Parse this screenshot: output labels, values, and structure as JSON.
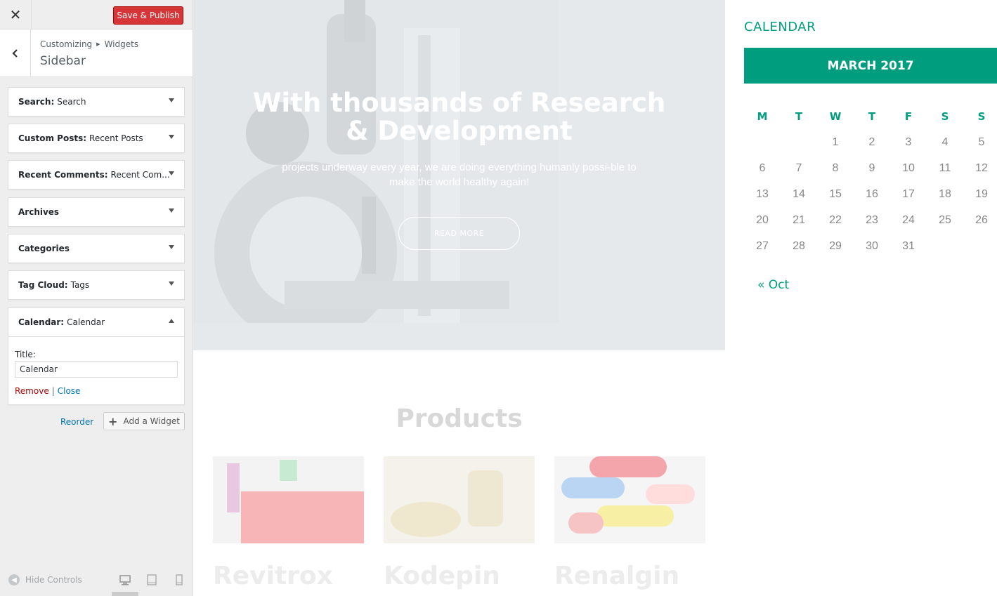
{
  "customizer": {
    "close_icon": "close-icon",
    "publish_label": "Save & Publish",
    "breadcrumb": [
      "Customizing",
      "Widgets"
    ],
    "section_title": "Sidebar",
    "widgets": [
      {
        "name": "Search:",
        "title": "Search"
      },
      {
        "name": "Custom Posts:",
        "title": "Recent Posts"
      },
      {
        "name": "Recent Comments:",
        "title": "Recent Com..."
      },
      {
        "name": "Archives",
        "title": ""
      },
      {
        "name": "Categories",
        "title": ""
      },
      {
        "name": "Tag Cloud:",
        "title": "Tags"
      },
      {
        "name": "Calendar:",
        "title": "Calendar"
      }
    ],
    "calendar_form": {
      "title_label": "Title:",
      "title_value": "Calendar",
      "remove_label": "Remove",
      "separator": "|",
      "close_label": "Close"
    },
    "reorder_label": "Reorder",
    "add_widget_label": "Add a Widget",
    "hide_controls_label": "Hide Controls"
  },
  "preview": {
    "hero": {
      "heading": "With thousands of Research & Development",
      "text": "projects underway every year, we are doing everything humanly possi-ble to make the world healthy again!",
      "button": "READ MORE"
    },
    "products_title": "Products",
    "products": [
      {
        "name": "Revitrox"
      },
      {
        "name": "Kodepin"
      },
      {
        "name": "Renalgin"
      }
    ],
    "calendar": {
      "widget_title": "CALENDAR",
      "caption": "MARCH 2017",
      "weekdays": [
        "M",
        "T",
        "W",
        "T",
        "F",
        "S",
        "S"
      ],
      "weeks": [
        [
          "",
          "",
          "1",
          "2",
          "3",
          "4",
          "5"
        ],
        [
          "6",
          "7",
          "8",
          "9",
          "10",
          "11",
          "12"
        ],
        [
          "13",
          "14",
          "15",
          "16",
          "17",
          "18",
          "19"
        ],
        [
          "20",
          "21",
          "22",
          "23",
          "24",
          "25",
          "26"
        ],
        [
          "27",
          "28",
          "29",
          "30",
          "31",
          "",
          ""
        ]
      ],
      "prev_link": "« Oct"
    }
  },
  "colors": {
    "accent": "#009e7e",
    "publish": "#d63638",
    "link": "#0073aa",
    "remove": "#aa0000"
  }
}
